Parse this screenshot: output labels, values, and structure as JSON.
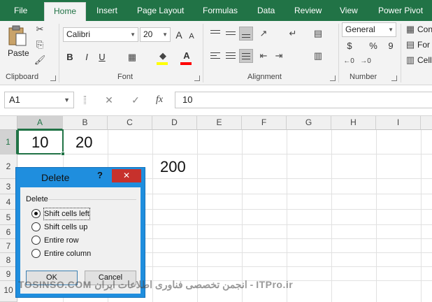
{
  "ribbon_tabs": [
    "File",
    "Home",
    "Insert",
    "Page Layout",
    "Formulas",
    "Data",
    "Review",
    "View",
    "Power Pivot"
  ],
  "active_tab": "Home",
  "clipboard": {
    "paste_label": "Paste",
    "group_label": "Clipboard"
  },
  "font": {
    "name": "Calibri",
    "size": "20",
    "group_label": "Font",
    "bold": "B",
    "italic": "I",
    "underline": "U",
    "grow": "A",
    "shrink": "A"
  },
  "alignment": {
    "group_label": "Alignment"
  },
  "number": {
    "format": "General",
    "group_label": "Number",
    "currency": "$",
    "percent": "%",
    "comma": "9"
  },
  "styles": {
    "conditional": "Con",
    "format_table": "For",
    "cell_styles": "Cell"
  },
  "formula_bar": {
    "name_box": "A1",
    "cancel": "✕",
    "enter": "✓",
    "fx": "fx",
    "value": "10"
  },
  "columns": [
    "A",
    "B",
    "C",
    "D",
    "E",
    "F",
    "G",
    "H",
    "I"
  ],
  "rows": [
    "1",
    "2",
    "3",
    "4",
    "5",
    "6",
    "7",
    "8",
    "9",
    "10"
  ],
  "cells": {
    "A1": "10",
    "B1": "20",
    "D2": "200"
  },
  "dialog": {
    "title": "Delete",
    "help": "?",
    "close": "✕",
    "group_label": "Delete",
    "options": [
      "Shift cells left",
      "Shift cells up",
      "Entire row",
      "Entire column"
    ],
    "selected": "Shift cells left",
    "ok_label": "OK",
    "cancel_label": "Cancel"
  },
  "watermark": "TOSINSO.COM انجمن تخصصی فناوری اطلاعات ایران - ITPro.ir",
  "colors": {
    "excel_green": "#217346",
    "dialog_blue": "#1f8ede",
    "close_red": "#c7312c"
  }
}
